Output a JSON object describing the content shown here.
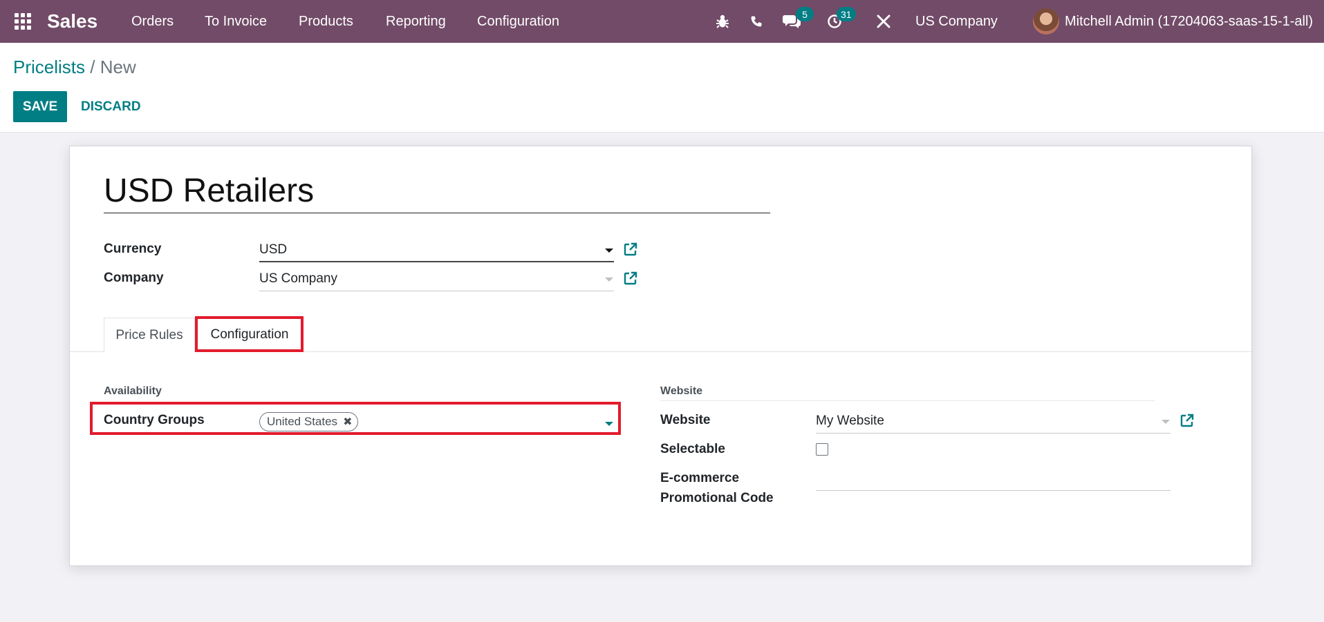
{
  "navbar": {
    "app_name": "Sales",
    "menu": [
      "Orders",
      "To Invoice",
      "Products",
      "Reporting",
      "Configuration"
    ],
    "messages_count": "5",
    "activities_count": "31",
    "company": "US Company",
    "user": "Mitchell Admin (17204063-saas-15-1-all)",
    "icons": [
      "apps-grid-icon",
      "bug-icon",
      "phone-icon",
      "chat-icon",
      "clock-icon",
      "tools-icon"
    ]
  },
  "breadcrumb": {
    "parent": "Pricelists",
    "separator": "/",
    "current": "New"
  },
  "buttons": {
    "save": "SAVE",
    "discard": "DISCARD"
  },
  "form": {
    "name": "USD Retailers",
    "currency_label": "Currency",
    "currency_value": "USD",
    "company_label": "Company",
    "company_value": "US Company"
  },
  "tabs": [
    {
      "label": "Price Rules",
      "active": false
    },
    {
      "label": "Configuration",
      "active": true
    }
  ],
  "availability": {
    "title": "Availability",
    "country_groups_label": "Country Groups",
    "tags": [
      "United States"
    ]
  },
  "website_group": {
    "title": "Website",
    "website_label": "Website",
    "website_value": "My Website",
    "selectable_label": "Selectable",
    "selectable_checked": false,
    "promo_label_line1": "E-commerce",
    "promo_label_line2": "Promotional Code",
    "promo_value": ""
  },
  "colors": {
    "navbar": "#714b67",
    "primary": "#017e84",
    "highlight": "#e21b2c"
  }
}
